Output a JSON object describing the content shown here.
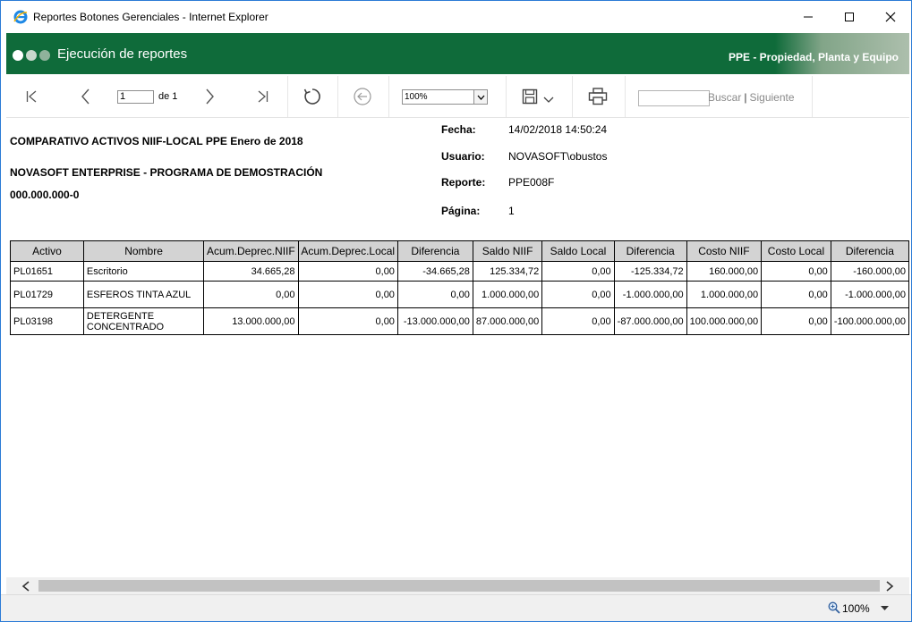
{
  "window": {
    "title": "Reportes Botones Gerenciales - Internet Explorer"
  },
  "banner": {
    "title": "Ejecución de reportes",
    "module": "PPE - Propiedad, Planta y Equipo"
  },
  "toolbar": {
    "page_value": "1",
    "page_of": "de 1",
    "zoom_value": "100%",
    "search_placeholder": "",
    "find_label": "Buscar",
    "next_label": "Siguiente"
  },
  "report": {
    "title": "COMPARATIVO ACTIVOS NIIF-LOCAL PPE Enero de  2018",
    "company": "NOVASOFT ENTERPRISE - PROGRAMA DE DEMOSTRACIÓN",
    "nit": "000.000.000-0",
    "meta": [
      {
        "label": "Fecha:",
        "value": "14/02/2018 14:50:24"
      },
      {
        "label": "Usuario:",
        "value": "NOVASOFT\\obustos"
      },
      {
        "label": "Reporte:",
        "value": "PPE008F"
      },
      {
        "label": "Página:",
        "value": "1"
      }
    ],
    "columns": [
      "Activo",
      "Nombre",
      "Acum.Deprec.NIIF",
      "Acum.Deprec.Local",
      "Diferencia",
      "Saldo NIIF",
      "Saldo Local",
      "Diferencia",
      "Costo NIIF",
      "Costo Local",
      "Diferencia"
    ],
    "rows": [
      [
        "PL01651",
        "Escritorio",
        "34.665,28",
        "0,00",
        "-34.665,28",
        "125.334,72",
        "0,00",
        "-125.334,72",
        "160.000,00",
        "0,00",
        "-160.000,00"
      ],
      [
        "PL01729",
        "ESFEROS TINTA AZUL",
        "0,00",
        "0,00",
        "0,00",
        "1.000.000,00",
        "0,00",
        "-1.000.000,00",
        "1.000.000,00",
        "0,00",
        "-1.000.000,00"
      ],
      [
        "PL03198",
        "DETERGENTE CONCENTRADO",
        "13.000.000,00",
        "0,00",
        "-13.000.000,00",
        "87.000.000,00",
        "0,00",
        "-87.000.000,00",
        "100.000.000,00",
        "0,00",
        "-100.000.000,00"
      ]
    ]
  },
  "statusbar": {
    "zoom": "100%"
  },
  "colors": {
    "banner_bg": "#0f6b3a",
    "header_cell_bg": "#d3d3d3",
    "window_border": "#2b7bd6"
  },
  "icons": {
    "app": "internet-explorer-icon",
    "minimize": "minimize-icon",
    "maximize": "maximize-icon",
    "close": "close-icon",
    "first_page": "first-page-icon",
    "prev_page": "previous-page-icon",
    "next_page": "next-page-icon",
    "last_page": "last-page-icon",
    "refresh": "refresh-icon",
    "back": "back-icon",
    "save": "save-icon",
    "print": "print-icon",
    "zoom": "magnifier-icon"
  }
}
